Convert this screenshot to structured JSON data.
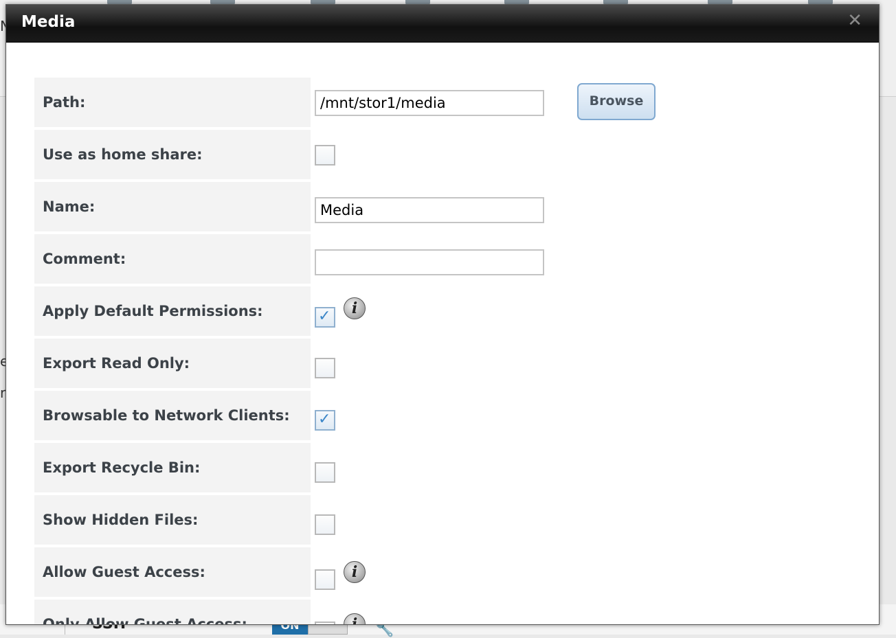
{
  "background": {
    "left_text_1": "N",
    "left_text_2": "e",
    "left_text_3": "re",
    "ssh_label": "SSH",
    "toggle_on_label": "ON"
  },
  "dialog": {
    "title": "Media",
    "close_glyph": "✕"
  },
  "form": {
    "path": {
      "label": "Path:",
      "value": "/mnt/stor1/media",
      "browse_label": "Browse"
    },
    "home_share": {
      "label": "Use as home share:",
      "checked": false
    },
    "name": {
      "label": "Name:",
      "value": "Media"
    },
    "comment": {
      "label": "Comment:",
      "value": ""
    },
    "default_permissions": {
      "label": "Apply Default Permissions:",
      "checked": true,
      "info_glyph": "i"
    },
    "read_only": {
      "label": "Export Read Only:",
      "checked": false
    },
    "browsable": {
      "label": "Browsable to Network Clients:",
      "checked": true
    },
    "recycle_bin": {
      "label": "Export Recycle Bin:",
      "checked": false
    },
    "hidden_files": {
      "label": "Show Hidden Files:",
      "checked": false
    },
    "guest_access": {
      "label": "Allow Guest Access:",
      "checked": false,
      "info_glyph": "i"
    },
    "only_guest": {
      "label": "Only Allow Guest Access:",
      "checked": false,
      "info_glyph": "i"
    }
  },
  "checkmark_glyph": "✓"
}
